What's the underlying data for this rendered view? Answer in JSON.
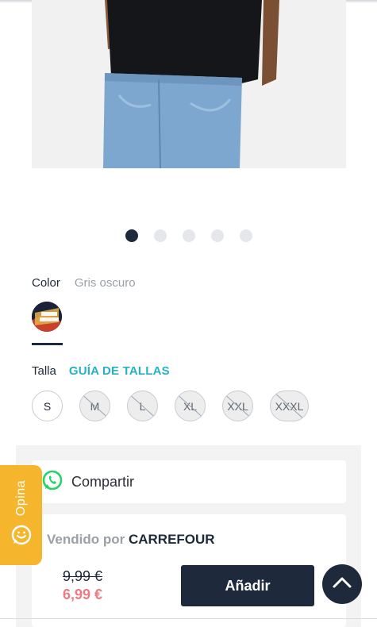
{
  "gallery": {
    "slide_count": 5,
    "active_index": 0
  },
  "color": {
    "label": "Color",
    "value": "Gris oscuro",
    "swatch_text": "I'M DOING"
  },
  "size": {
    "label": "Talla",
    "guide_link": "GUÍA DE TALLAS",
    "options": [
      {
        "label": "S",
        "available": true
      },
      {
        "label": "M",
        "available": false
      },
      {
        "label": "L",
        "available": false
      },
      {
        "label": "XL",
        "available": false
      },
      {
        "label": "XXL",
        "available": false
      },
      {
        "label": "XXXL",
        "available": false
      }
    ]
  },
  "share": {
    "label": "Compartir",
    "icon": "whatsapp-icon"
  },
  "seller": {
    "sold_by": "Vendido por",
    "name": "CARREFOUR"
  },
  "price": {
    "old": "9,99 €",
    "new": "6,99 €"
  },
  "actions": {
    "add_label": "Añadir"
  },
  "feedback_tab": {
    "label": "Opina",
    "icon": "chat-smile-icon"
  },
  "colors": {
    "navy": "#1e2a3b",
    "accent_teal": "#27b1c4",
    "sale_red": "#ec7c83",
    "opina_yellow": "#f5b62e",
    "whatsapp_green": "#25d366"
  }
}
